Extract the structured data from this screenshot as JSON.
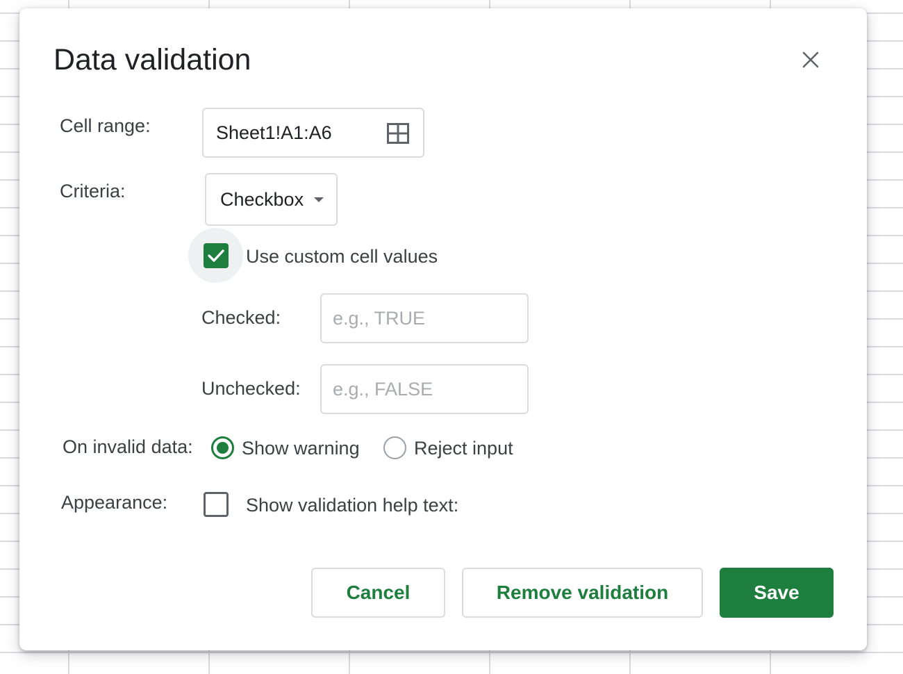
{
  "dialog": {
    "title": "Data validation",
    "close_icon": "close-icon"
  },
  "cell_range": {
    "label": "Cell range:",
    "value": "Sheet1!A1:A6",
    "icon": "grid-select-icon"
  },
  "criteria": {
    "label": "Criteria:",
    "selected": "Checkbox",
    "dropdown_icon": "caret-down-icon",
    "custom_values": {
      "label": "Use custom cell values",
      "checked": true
    },
    "checked_field": {
      "label": "Checked:",
      "value": "",
      "placeholder": "e.g., TRUE"
    },
    "unchecked_field": {
      "label": "Unchecked:",
      "value": "",
      "placeholder": "e.g., FALSE"
    }
  },
  "invalid_data": {
    "label": "On invalid data:",
    "options": [
      {
        "label": "Show warning",
        "selected": true
      },
      {
        "label": "Reject input",
        "selected": false
      }
    ]
  },
  "appearance": {
    "label": "Appearance:",
    "help_text_label": "Show validation help text:",
    "help_text_checked": false
  },
  "buttons": {
    "cancel": "Cancel",
    "remove": "Remove validation",
    "save": "Save"
  },
  "colors": {
    "accent": "#1e7e3e",
    "border": "#dadce0",
    "text": "#202124",
    "placeholder": "#a9abae"
  }
}
